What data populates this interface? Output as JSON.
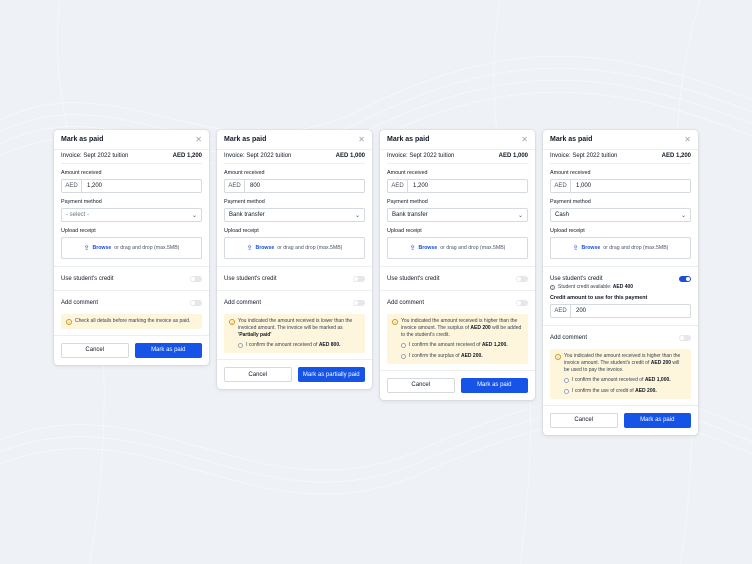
{
  "cards": [
    {
      "title": "Mark as paid",
      "invoice_label": "Invoice: Sept 2022 tuition",
      "invoice_amount": "AED 1,200",
      "amount_label": "Amount received",
      "currency": "AED",
      "amount_value": "1,200",
      "payment_label": "Payment method",
      "payment_value": "- select -",
      "upload_label": "Upload receipt",
      "browse": "Browse",
      "upload_hint": "or drag and drop (max.5MB)",
      "credit_label": "Use student's credit",
      "comment_label": "Add comment",
      "note": "Check all details before marking the invoice as paid.",
      "cancel": "Cancel",
      "submit": "Mark as paid"
    },
    {
      "title": "Mark as paid",
      "invoice_label": "Invoice: Sept 2022 tuition",
      "invoice_amount": "AED 1,000",
      "amount_label": "Amount received",
      "currency": "AED",
      "amount_value": "800",
      "payment_label": "Payment method",
      "payment_value": "Bank transfer",
      "upload_label": "Upload receipt",
      "browse": "Browse",
      "upload_hint": "or drag and drop (max.5MB)",
      "credit_label": "Use student's credit",
      "comment_label": "Add comment",
      "note_a": "You indicated the amount received is lower than the invoiced amount. The invoice will be marked as ",
      "note_b": "'Partially paid'",
      "confirm1_a": "I confirm the amount received of ",
      "confirm1_b": "AED 800.",
      "cancel": "Cancel",
      "submit": "Mark as partially paid"
    },
    {
      "title": "Mark as paid",
      "invoice_label": "Invoice: Sept 2022 tuition",
      "invoice_amount": "AED 1,000",
      "amount_label": "Amount received",
      "currency": "AED",
      "amount_value": "1,200",
      "payment_label": "Payment method",
      "payment_value": "Bank transfer",
      "upload_label": "Upload receipt",
      "browse": "Browse",
      "upload_hint": "or drag and drop (max.5MB)",
      "credit_label": "Use student's credit",
      "comment_label": "Add comment",
      "note_a": "You indicated the amount received is higher than the invoice amount. The surplus of ",
      "note_b": "AED 200",
      "note_c": " will be added to the student's credit.",
      "confirm1_a": "I confirm the amount received of ",
      "confirm1_b": "AED 1,200.",
      "confirm2_a": "I confirm the surplus of ",
      "confirm2_b": "AED 200.",
      "cancel": "Cancel",
      "submit": "Mark as paid"
    },
    {
      "title": "Mark as paid",
      "invoice_label": "Invoice: Sept 2022 tuition",
      "invoice_amount": "AED 1,200",
      "amount_label": "Amount received",
      "currency": "AED",
      "amount_value": "1,000",
      "payment_label": "Payment method",
      "payment_value": "Cash",
      "upload_label": "Upload receipt",
      "browse": "Browse",
      "upload_hint": "or drag and drop (max.5MB)",
      "credit_label": "Use student's credit",
      "credit_avail_a": "Student credit available: ",
      "credit_avail_b": "AED 400",
      "credit_amount_label": "Credit amount to use for this payment",
      "credit_amount_value": "200",
      "comment_label": "Add comment",
      "note_a": "You indicated the amount received is higher than the invoice amount. The student's credit of ",
      "note_b": "AED 200",
      "note_c": " will be used to pay the invoice.",
      "confirm1_a": "I confirm the amount received of ",
      "confirm1_b": "AED 1,000.",
      "confirm2_a": "I confirm the use of credit of ",
      "confirm2_b": "AED 200.",
      "cancel": "Cancel",
      "submit": "Mark as paid"
    }
  ],
  "colors": {
    "primary": "#1554e6",
    "warning_bg": "#fdf6dd",
    "warning_icon": "#d49a1a",
    "page_bg": "#eef1f5"
  },
  "icons": {
    "close": "close-icon",
    "upload": "upload-icon",
    "chevron": "chevron-down-icon",
    "warning": "warning-icon",
    "info": "info-icon"
  }
}
